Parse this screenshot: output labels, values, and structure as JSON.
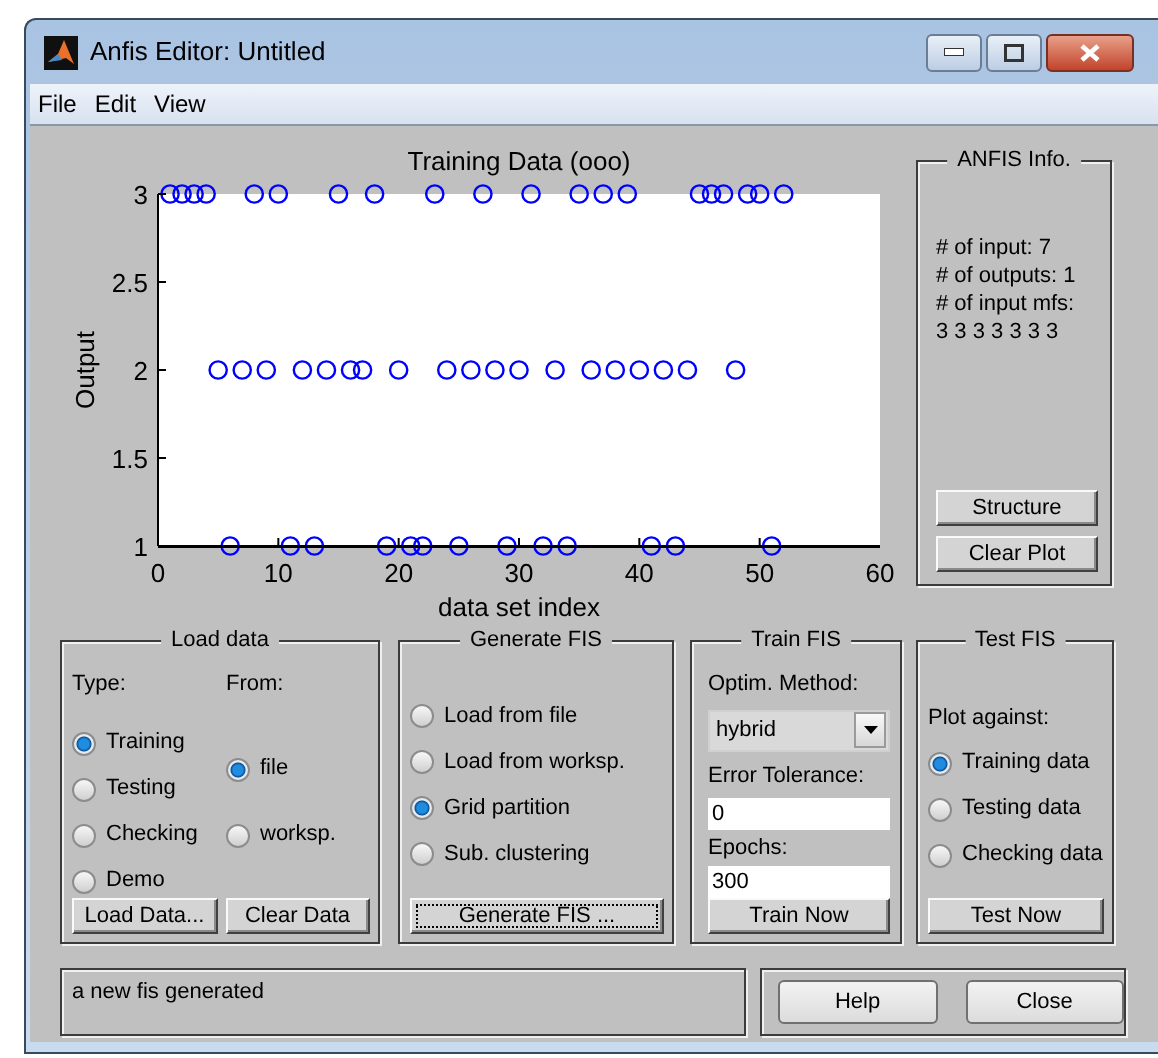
{
  "window": {
    "title": "Anfis Editor: Untitled"
  },
  "menu": [
    "File",
    "Edit",
    "View"
  ],
  "plot": {
    "chart_data": {
      "type": "scatter",
      "title": "Training Data (ooo)",
      "xlabel": "data set index",
      "ylabel": "Output",
      "x": [
        1,
        2,
        3,
        4,
        5,
        6,
        7,
        8,
        9,
        10,
        11,
        12,
        13,
        14,
        15,
        16,
        17,
        18,
        19,
        20,
        21,
        22,
        23,
        24,
        25,
        26,
        27,
        28,
        29,
        30,
        31,
        32,
        33,
        34,
        35,
        36,
        37,
        38,
        39,
        40,
        41,
        42,
        43,
        44,
        45,
        46,
        47,
        48,
        49,
        50,
        51,
        52
      ],
      "series": [
        {
          "color": "#0000ff",
          "values": [
            3,
            3,
            3,
            3,
            2,
            1,
            2,
            3,
            2,
            3,
            1,
            2,
            1,
            2,
            3,
            2,
            2,
            3,
            1,
            2,
            1,
            1,
            3,
            2,
            1,
            2,
            3,
            2,
            1,
            2,
            3,
            1,
            2,
            1,
            3,
            2,
            3,
            2,
            3,
            2,
            1,
            2,
            1,
            2,
            3,
            3,
            3,
            2,
            3,
            3,
            1,
            3
          ]
        }
      ],
      "xlim": [
        0,
        60
      ],
      "ylim": [
        1,
        3
      ],
      "xticks": [
        0,
        10,
        20,
        30,
        40,
        50,
        60
      ],
      "yticks": [
        1,
        1.5,
        2,
        2.5,
        3
      ]
    }
  },
  "anfis_info": {
    "title": "ANFIS Info.",
    "lines": [
      "# of input: 7",
      "# of outputs: 1",
      "# of input mfs:",
      "3 3 3 3 3 3 3"
    ],
    "buttons": [
      "Structure",
      "Clear Plot"
    ]
  },
  "load_data": {
    "title": "Load data",
    "type_label": "Type:",
    "from_label": "From:",
    "types": [
      {
        "label": "Training",
        "selected": true
      },
      {
        "label": "Testing",
        "selected": false
      },
      {
        "label": "Checking",
        "selected": false
      },
      {
        "label": "Demo",
        "selected": false
      }
    ],
    "sources": [
      {
        "label": "file",
        "selected": true
      },
      {
        "label": "worksp.",
        "selected": false
      }
    ],
    "buttons": [
      "Load Data...",
      "Clear Data"
    ]
  },
  "generate_fis": {
    "title": "Generate FIS",
    "options": [
      {
        "label": "Load from file",
        "selected": false
      },
      {
        "label": "Load from worksp.",
        "selected": false
      },
      {
        "label": "Grid partition",
        "selected": true
      },
      {
        "label": "Sub. clustering",
        "selected": false
      }
    ],
    "button": {
      "label": "Generate FIS ...",
      "focused": true
    }
  },
  "train_fis": {
    "title": "Train FIS",
    "method_label": "Optim. Method:",
    "method": "hybrid",
    "tolerance_label": "Error Tolerance:",
    "tolerance": "0",
    "epochs_label": "Epochs:",
    "epochs": "300",
    "button": "Train Now"
  },
  "test_fis": {
    "title": "Test FIS",
    "plot_label": "Plot against:",
    "options": [
      {
        "label": "Training data",
        "selected": true
      },
      {
        "label": "Testing data",
        "selected": false
      },
      {
        "label": "Checking data",
        "selected": false
      }
    ],
    "button": "Test Now"
  },
  "status": "a new fis generated",
  "buttons": [
    "Help",
    "Close"
  ]
}
